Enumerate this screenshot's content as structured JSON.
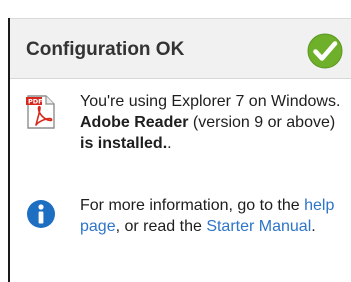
{
  "status": {
    "title": "Configuration OK",
    "ok_icon": "check-circle-icon",
    "ok_color": "#6fb02a"
  },
  "browser_message": {
    "icon": "pdf-document-icon",
    "intro": "You're using Explorer 7 on Windows. ",
    "reader": "Adobe Reader",
    "version": " (version 9 or above) ",
    "installed": "is installed.",
    "trailing": "."
  },
  "help_message": {
    "icon": "info-icon",
    "intro": "For more information, go to the ",
    "help_link": "help page",
    "middle": ", or read the ",
    "manual_link": "Starter Manual",
    "trailing": "."
  },
  "colors": {
    "link": "#2e74c8",
    "header_bg": "#f1f1f1",
    "info_blue": "#1d6fc2",
    "pdf_red": "#d8281e"
  }
}
